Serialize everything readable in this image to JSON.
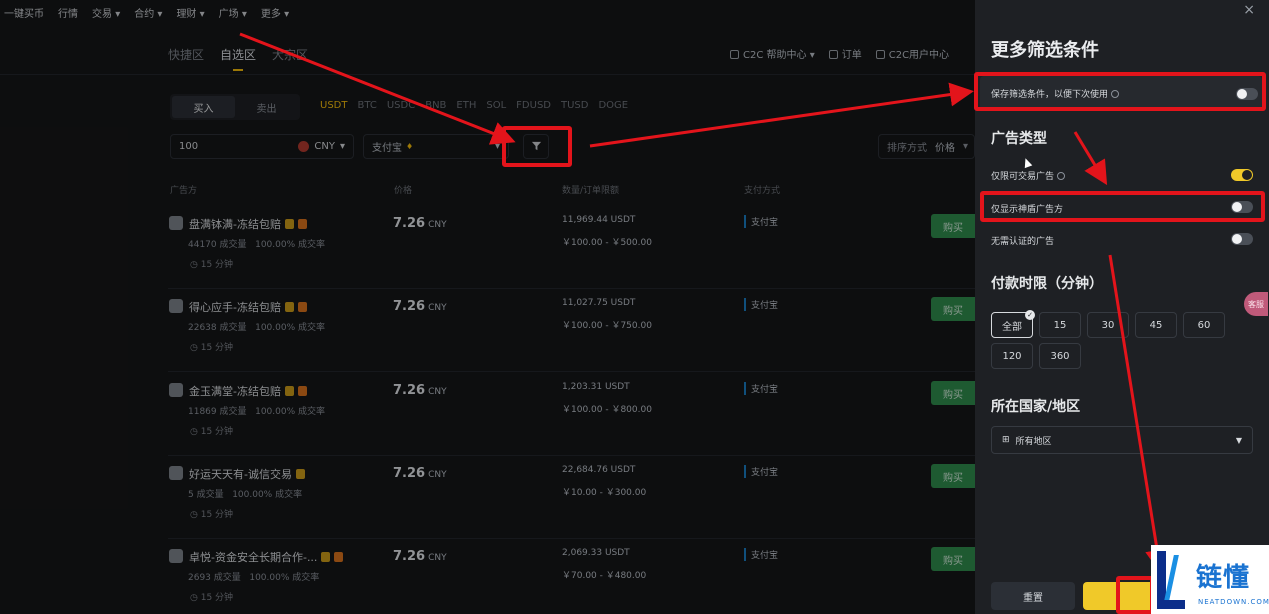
{
  "nav": {
    "items": [
      "一键买币",
      "行情",
      "交易",
      "合约",
      "理财",
      "广场",
      "更多"
    ]
  },
  "tabs": {
    "items": [
      "快捷区",
      "自选区",
      "大宗区"
    ],
    "active": 1
  },
  "header_links": {
    "help": "C2C 帮助中心",
    "orders": "订单",
    "user_center": "C2C用户中心"
  },
  "trade": {
    "buy_label": "买入",
    "sell_label": "卖出",
    "coins": [
      "USDT",
      "BTC",
      "USDC",
      "BNB",
      "ETH",
      "SOL",
      "FDUSD",
      "TUSD",
      "DOGE"
    ],
    "selected_coin": "USDT"
  },
  "filters": {
    "amount_value": "100",
    "currency": "CNY",
    "payment_method": "支付宝",
    "sort_label": "排序方式",
    "sort_value": "价格"
  },
  "table": {
    "headers": {
      "advertiser": "广告方",
      "price": "价格",
      "quantity": "数量/订单限额",
      "payment": "支付方式"
    },
    "rows": [
      {
        "name": "盘满钵满-冻结包赔",
        "trades": "44170 成交量",
        "rate": "100.00% 成交率",
        "time": "15 分钟",
        "price": "7.26",
        "currency": "CNY",
        "quantity": "11,969.44 USDT",
        "limit": "￥100.00 - ￥500.00",
        "payment": "支付宝",
        "action": "购买"
      },
      {
        "name": "得心应手-冻结包赔",
        "trades": "22638 成交量",
        "rate": "100.00% 成交率",
        "time": "15 分钟",
        "price": "7.26",
        "currency": "CNY",
        "quantity": "11,027.75 USDT",
        "limit": "￥100.00 - ￥750.00",
        "payment": "支付宝",
        "action": "购买"
      },
      {
        "name": "金玉满堂-冻结包赔",
        "trades": "11869 成交量",
        "rate": "100.00% 成交率",
        "time": "15 分钟",
        "price": "7.26",
        "currency": "CNY",
        "quantity": "1,203.31 USDT",
        "limit": "￥100.00 - ￥800.00",
        "payment": "支付宝",
        "action": "购买"
      },
      {
        "name": "好运天天有-诚信交易",
        "trades": "5 成交量",
        "rate": "100.00% 成交率",
        "time": "15 分钟",
        "price": "7.26",
        "currency": "CNY",
        "quantity": "22,684.76 USDT",
        "limit": "￥10.00 - ￥300.00",
        "payment": "支付宝",
        "action": "购买"
      },
      {
        "name": "卓悦-资金安全长期合作-...",
        "trades": "2693 成交量",
        "rate": "100.00% 成交率",
        "time": "15 分钟",
        "price": "7.26",
        "currency": "CNY",
        "quantity": "2,069.33 USDT",
        "limit": "￥70.00 - ￥480.00",
        "payment": "支付宝",
        "action": "购买"
      }
    ]
  },
  "drawer": {
    "close": "×",
    "title": "更多筛选条件",
    "save_filter": "保存筛选条件，以便下次使用",
    "ad_type_title": "广告类型",
    "opt_tradable": "仅限可交易广告",
    "opt_verified": "仅显示神盾广告方",
    "opt_no_verify": "无需认证的广告",
    "payment_time_title": "付款时限（分钟）",
    "time_chips": [
      "全部",
      "15",
      "30",
      "45",
      "60",
      "120",
      "360"
    ],
    "time_selected": 0,
    "region_title": "所在国家/地区",
    "region_value": "所有地区",
    "reset": "重置"
  },
  "chat": "客服",
  "watermark": {
    "cn": "链懂",
    "en": "NEATDOWN.COM"
  },
  "colors": {
    "accent": "#f0b90b",
    "buy_green": "#2e8a4c",
    "annotation_red": "#e3141b",
    "toggle_on": "#f0c929"
  }
}
